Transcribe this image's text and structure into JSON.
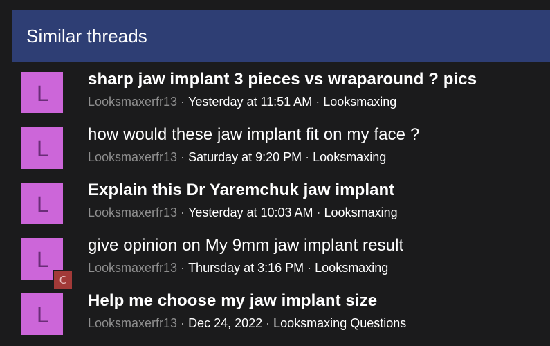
{
  "header": {
    "title": "Similar threads"
  },
  "threads": [
    {
      "avatar_letter": "L",
      "title": "sharp jaw implant 3 pieces vs wraparound ? pics",
      "bold": true,
      "author": "Looksmaxerfr13",
      "date": "Yesterday at 11:51 AM",
      "forum": "Looksmaxing"
    },
    {
      "avatar_letter": "L",
      "title": "how would these jaw implant fit on my face ?",
      "bold": false,
      "author": "Looksmaxerfr13",
      "date": "Saturday at 9:20 PM",
      "forum": "Looksmaxing"
    },
    {
      "avatar_letter": "L",
      "title": "Explain this Dr Yaremchuk jaw implant",
      "bold": true,
      "author": "Looksmaxerfr13",
      "date": "Yesterday at 10:03 AM",
      "forum": "Looksmaxing"
    },
    {
      "avatar_letter": "L",
      "mini_avatar_letter": "C",
      "title": "give opinion on My 9mm jaw implant result",
      "bold": false,
      "author": "Looksmaxerfr13",
      "date": "Thursday at 3:16 PM",
      "forum": "Looksmaxing"
    },
    {
      "avatar_letter": "L",
      "title": "Help me choose my jaw implant size",
      "bold": true,
      "author": "Looksmaxerfr13",
      "date": "Dec 24, 2022",
      "forum": "Looksmaxing Questions"
    }
  ],
  "meta_separator": "·",
  "colors": {
    "header_bg": "#2e3e74",
    "avatar_bg": "#cc66d9",
    "mini_avatar_bg": "#a23a38",
    "page_bg": "#1b1b1c"
  }
}
